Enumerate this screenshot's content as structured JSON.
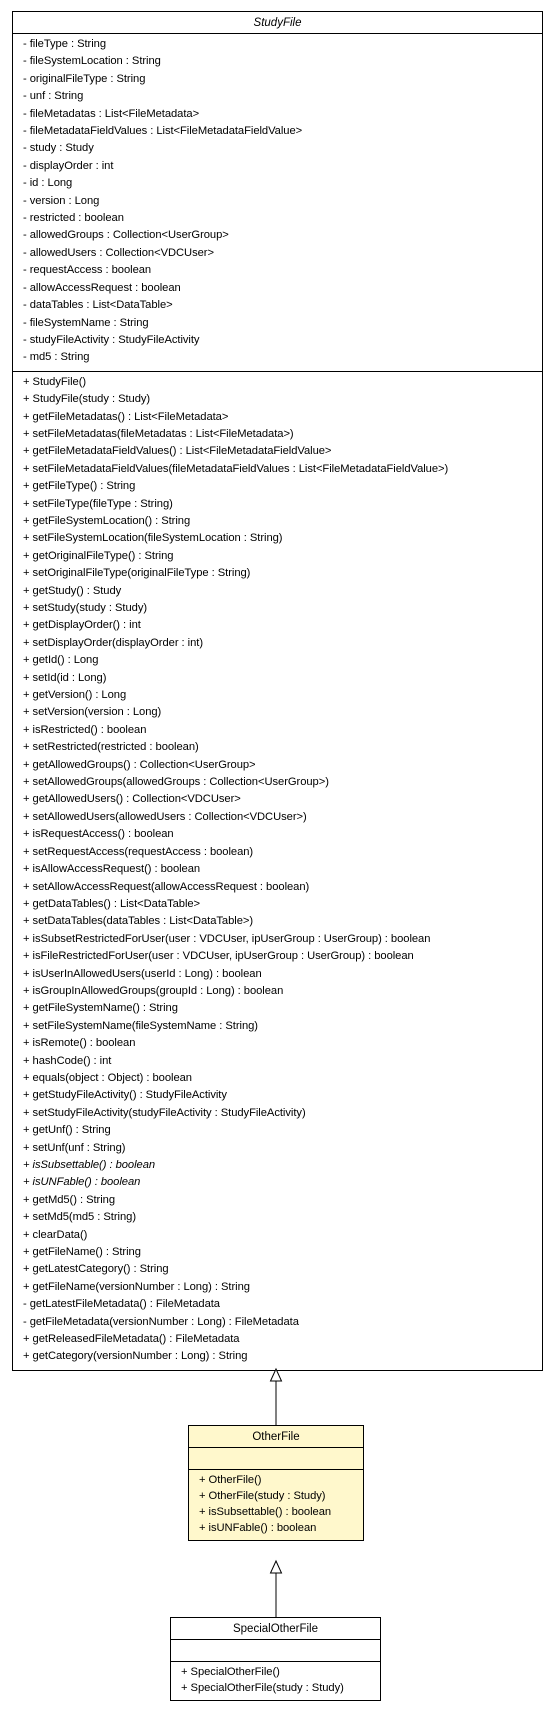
{
  "classes": {
    "studyfile": {
      "name": "StudyFile",
      "attributes": [
        "- fileType : String",
        "- fileSystemLocation : String",
        "- originalFileType : String",
        "- unf : String",
        "- fileMetadatas : List<FileMetadata>",
        "- fileMetadataFieldValues : List<FileMetadataFieldValue>",
        "- study : Study",
        "- displayOrder : int",
        "- id : Long",
        "- version : Long",
        "- restricted : boolean",
        "- allowedGroups : Collection<UserGroup>",
        "- allowedUsers : Collection<VDCUser>",
        "- requestAccess : boolean",
        "- allowAccessRequest : boolean",
        "- dataTables : List<DataTable>",
        "- fileSystemName : String",
        "- studyFileActivity : StudyFileActivity",
        "- md5 : String"
      ],
      "operations": [
        {
          "text": "+ StudyFile()",
          "abstract": false
        },
        {
          "text": "+ StudyFile(study : Study)",
          "abstract": false
        },
        {
          "text": "+ getFileMetadatas() : List<FileMetadata>",
          "abstract": false
        },
        {
          "text": "+ setFileMetadatas(fileMetadatas : List<FileMetadata>)",
          "abstract": false
        },
        {
          "text": "+ getFileMetadataFieldValues() : List<FileMetadataFieldValue>",
          "abstract": false
        },
        {
          "text": "+ setFileMetadataFieldValues(fileMetadataFieldValues : List<FileMetadataFieldValue>)",
          "abstract": false
        },
        {
          "text": "+ getFileType() : String",
          "abstract": false
        },
        {
          "text": "+ setFileType(fileType : String)",
          "abstract": false
        },
        {
          "text": "+ getFileSystemLocation() : String",
          "abstract": false
        },
        {
          "text": "+ setFileSystemLocation(fileSystemLocation : String)",
          "abstract": false
        },
        {
          "text": "+ getOriginalFileType() : String",
          "abstract": false
        },
        {
          "text": "+ setOriginalFileType(originalFileType : String)",
          "abstract": false
        },
        {
          "text": "+ getStudy() : Study",
          "abstract": false
        },
        {
          "text": "+ setStudy(study : Study)",
          "abstract": false
        },
        {
          "text": "+ getDisplayOrder() : int",
          "abstract": false
        },
        {
          "text": "+ setDisplayOrder(displayOrder : int)",
          "abstract": false
        },
        {
          "text": "+ getId() : Long",
          "abstract": false
        },
        {
          "text": "+ setId(id : Long)",
          "abstract": false
        },
        {
          "text": "+ getVersion() : Long",
          "abstract": false
        },
        {
          "text": "+ setVersion(version : Long)",
          "abstract": false
        },
        {
          "text": "+ isRestricted() : boolean",
          "abstract": false
        },
        {
          "text": "+ setRestricted(restricted : boolean)",
          "abstract": false
        },
        {
          "text": "+ getAllowedGroups() : Collection<UserGroup>",
          "abstract": false
        },
        {
          "text": "+ setAllowedGroups(allowedGroups : Collection<UserGroup>)",
          "abstract": false
        },
        {
          "text": "+ getAllowedUsers() : Collection<VDCUser>",
          "abstract": false
        },
        {
          "text": "+ setAllowedUsers(allowedUsers : Collection<VDCUser>)",
          "abstract": false
        },
        {
          "text": "+ isRequestAccess() : boolean",
          "abstract": false
        },
        {
          "text": "+ setRequestAccess(requestAccess : boolean)",
          "abstract": false
        },
        {
          "text": "+ isAllowAccessRequest() : boolean",
          "abstract": false
        },
        {
          "text": "+ setAllowAccessRequest(allowAccessRequest : boolean)",
          "abstract": false
        },
        {
          "text": "+ getDataTables() : List<DataTable>",
          "abstract": false
        },
        {
          "text": "+ setDataTables(dataTables : List<DataTable>)",
          "abstract": false
        },
        {
          "text": "+ isSubsetRestrictedForUser(user : VDCUser, ipUserGroup : UserGroup) : boolean",
          "abstract": false
        },
        {
          "text": "+ isFileRestrictedForUser(user : VDCUser, ipUserGroup : UserGroup) : boolean",
          "abstract": false
        },
        {
          "text": "+ isUserInAllowedUsers(userId : Long) : boolean",
          "abstract": false
        },
        {
          "text": "+ isGroupInAllowedGroups(groupId : Long) : boolean",
          "abstract": false
        },
        {
          "text": "+ getFileSystemName() : String",
          "abstract": false
        },
        {
          "text": "+ setFileSystemName(fileSystemName : String)",
          "abstract": false
        },
        {
          "text": "+ isRemote() : boolean",
          "abstract": false
        },
        {
          "text": "+ hashCode() : int",
          "abstract": false
        },
        {
          "text": "+ equals(object : Object) : boolean",
          "abstract": false
        },
        {
          "text": "+ getStudyFileActivity() : StudyFileActivity",
          "abstract": false
        },
        {
          "text": "+ setStudyFileActivity(studyFileActivity : StudyFileActivity)",
          "abstract": false
        },
        {
          "text": "+ getUnf() : String",
          "abstract": false
        },
        {
          "text": "+ setUnf(unf : String)",
          "abstract": false
        },
        {
          "text": "+ isSubsettable() : boolean",
          "abstract": true
        },
        {
          "text": "+ isUNFable() : boolean",
          "abstract": true
        },
        {
          "text": "+ getMd5() : String",
          "abstract": false
        },
        {
          "text": "+ setMd5(md5 : String)",
          "abstract": false
        },
        {
          "text": "+ clearData()",
          "abstract": false
        },
        {
          "text": "+ getFileName() : String",
          "abstract": false
        },
        {
          "text": "+ getLatestCategory() : String",
          "abstract": false
        },
        {
          "text": "+ getFileName(versionNumber : Long) : String",
          "abstract": false
        },
        {
          "text": "- getLatestFileMetadata() : FileMetadata",
          "abstract": false
        },
        {
          "text": "- getFileMetadata(versionNumber : Long) : FileMetadata",
          "abstract": false
        },
        {
          "text": "+ getReleasedFileMetadata() : FileMetadata",
          "abstract": false
        },
        {
          "text": "+ getCategory(versionNumber : Long) : String",
          "abstract": false
        }
      ]
    },
    "otherfile": {
      "name": "OtherFile",
      "attributes": [],
      "operations": [
        {
          "text": "+ OtherFile()",
          "abstract": false
        },
        {
          "text": "+ OtherFile(study : Study)",
          "abstract": false
        },
        {
          "text": "+ isSubsettable() : boolean",
          "abstract": false
        },
        {
          "text": "+ isUNFable() : boolean",
          "abstract": false
        }
      ]
    },
    "specialotherfile": {
      "name": "SpecialOtherFile",
      "attributes": [],
      "operations": [
        {
          "text": "+ SpecialOtherFile()",
          "abstract": false
        },
        {
          "text": "+ SpecialOtherFile(study : Study)",
          "abstract": false
        }
      ]
    }
  },
  "relations": [
    {
      "type": "generalization",
      "from": "OtherFile",
      "to": "StudyFile"
    },
    {
      "type": "generalization",
      "from": "SpecialOtherFile",
      "to": "OtherFile"
    }
  ],
  "colors": {
    "highlight_fill": "#fff8cc",
    "line": "#000000"
  }
}
